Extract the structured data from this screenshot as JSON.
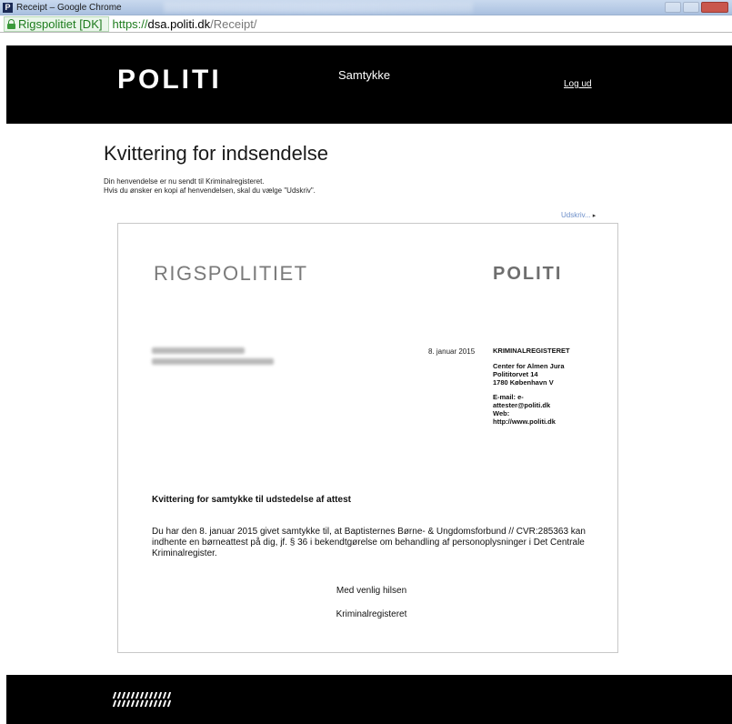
{
  "browser": {
    "window_title": "Receipt – Google Chrome",
    "favicon_letter": "P",
    "ev_label": "Rigspolitiet [DK]",
    "url_scheme": "https://",
    "url_host": "dsa.politi.dk",
    "url_path": "/Receipt/"
  },
  "header": {
    "logo": "POLITI",
    "nav_title": "Samtykke",
    "logout": "Log ud"
  },
  "page": {
    "title": "Kvittering for indsendelse",
    "intro_line1": "Din henvendelse er nu sendt til Kriminalregisteret.",
    "intro_line2": "Hvis du ønsker en kopi af henvendelsen, skal du vælge \"Udskriv\".",
    "print_link": "Udskriv..."
  },
  "receipt": {
    "org": "RIGSPOLITIET",
    "logo": "POLITI",
    "date": "8. januar 2015",
    "department": "KRIMINALREGISTERET",
    "address": [
      "Center for Almen Jura",
      "Polititorvet 14",
      "1780 København V"
    ],
    "contact": [
      "E-mail: e-",
      "attester@politi.dk",
      "Web:",
      "http://www.politi.dk"
    ],
    "heading": "Kvittering for samtykke til udstedelse af attest",
    "body": "Du har den 8. januar 2015 givet samtykke til, at Baptisternes Børne- & Ungdomsforbund // CVR:285363 kan indhente en børneattest på dig, jf. § 36 i bekendtgørelse om behandling af personoplysninger i Det Centrale Kriminalregister.",
    "closing": "Med venlig hilsen",
    "signature": "Kriminalregisteret"
  }
}
